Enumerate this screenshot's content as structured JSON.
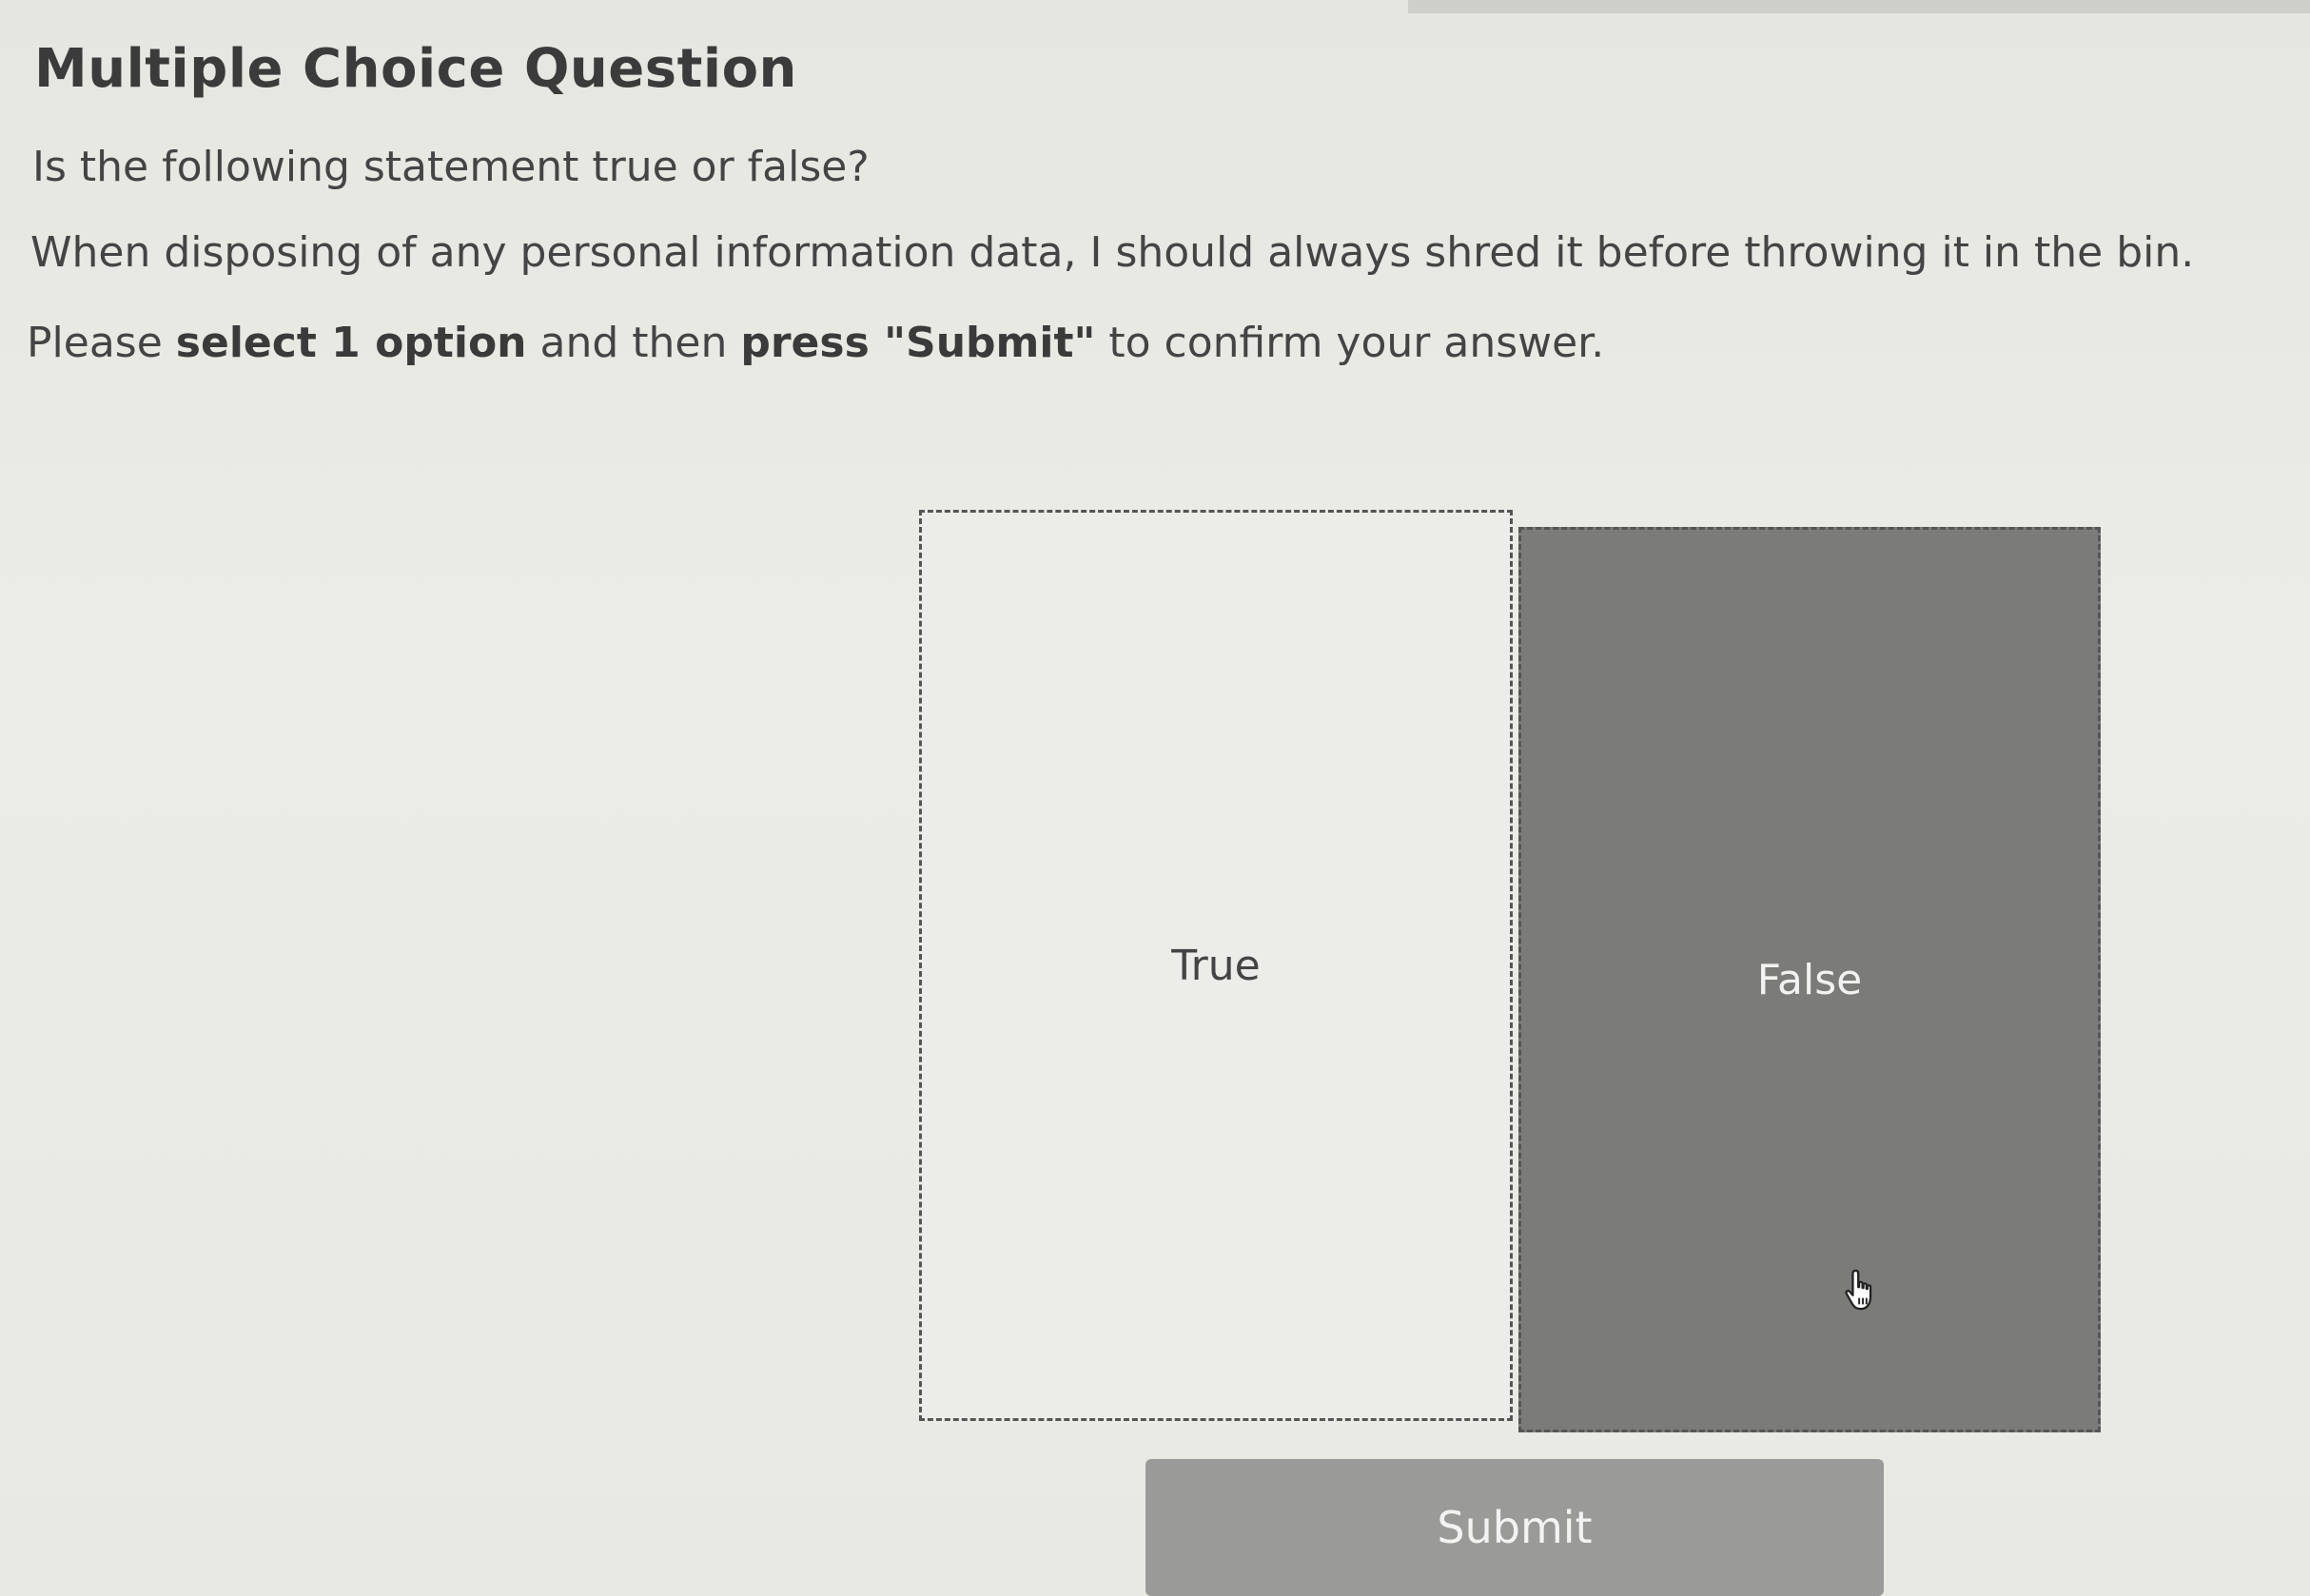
{
  "header": {
    "title": "Multiple Choice Question"
  },
  "content": {
    "question": "Is the following statement true or false?",
    "statement": "When disposing of any personal information data, I should always shred it before throwing it in the bin.",
    "instructions": {
      "part1": "Please ",
      "part2": "select 1 option",
      "part3": " and then ",
      "part4": "press \"Submit\"",
      "part5": " to confirm your answer."
    }
  },
  "options": [
    {
      "label": "True",
      "selected": false
    },
    {
      "label": "False",
      "selected": true
    }
  ],
  "submit": {
    "label": "Submit"
  },
  "colors": {
    "background": "#e8e8e3",
    "selected_option": "#7b7c79",
    "submit_button": "#9a9b98"
  },
  "icons": {
    "cursor": "hand-pointer-icon"
  }
}
